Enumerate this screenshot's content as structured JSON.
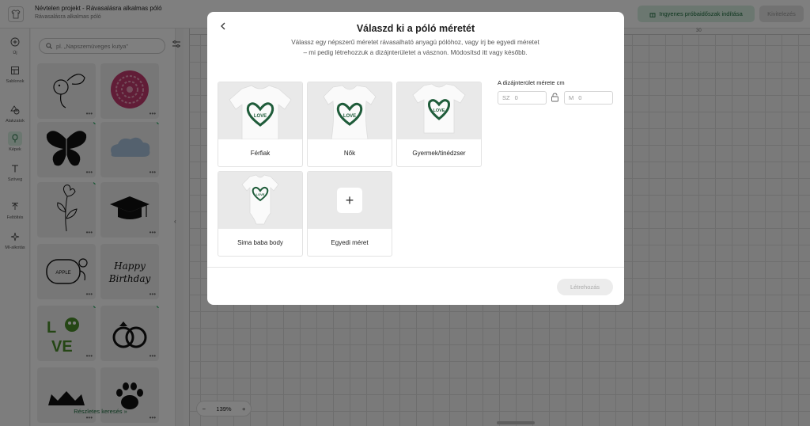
{
  "app": {
    "project_title": "Névtelen projekt - Rávasalásra alkalmas póló",
    "project_subtitle": "Rávasalásra alkalmas póló",
    "trial_button": "Ingyenes próbaidőszak indítása",
    "export_button": "Kivitelezés",
    "ruler_mark": "30",
    "zoom_level": "139%",
    "zoom_minus": "−",
    "zoom_plus": "+"
  },
  "rail": {
    "items": [
      {
        "label": "Új",
        "icon": "plus-icon"
      },
      {
        "label": "Sablonok",
        "icon": "template-icon"
      },
      {
        "label": "Alakzatok",
        "icon": "shapes-icon"
      },
      {
        "label": "Képek",
        "icon": "image-icon"
      },
      {
        "label": "Szöveg",
        "icon": "text-icon"
      },
      {
        "label": "Feltöltés",
        "icon": "upload-icon"
      },
      {
        "label": "MI-alkotás",
        "icon": "sparkle-icon"
      }
    ]
  },
  "panel": {
    "search_placeholder": "pl. „Napszemüveges kutya”",
    "more_link": "Részletes keresés",
    "tile_labels": [
      "APPLE",
      "Happy",
      "Birthday",
      "L",
      "VE"
    ]
  },
  "modal": {
    "title": "Válaszd ki a póló méretét",
    "description": "Válassz egy népszerű méretet rávasalható anyagú pólóhoz, vagy írj be egyedi méretet – mi pedig létrehozzuk a dizájnterületet a vásznon. Módosítsd itt vagy később.",
    "cards": [
      {
        "label": "Férfiak"
      },
      {
        "label": "Nők"
      },
      {
        "label": "Gyermek/tinédzser"
      },
      {
        "label": "Sima baba body"
      },
      {
        "label": "Egyedi méret"
      }
    ],
    "shirt_print": "LOVE",
    "size_label": "A dizájnterület mérete cm",
    "width_prefix": "SZ",
    "width_value": "0",
    "height_prefix": "M",
    "height_value": "0",
    "create_button": "Létrehozás"
  },
  "colors": {
    "brand_green": "#1a6b3c",
    "accent_light": "#d7efe0",
    "heart": "#1f5c3a"
  }
}
